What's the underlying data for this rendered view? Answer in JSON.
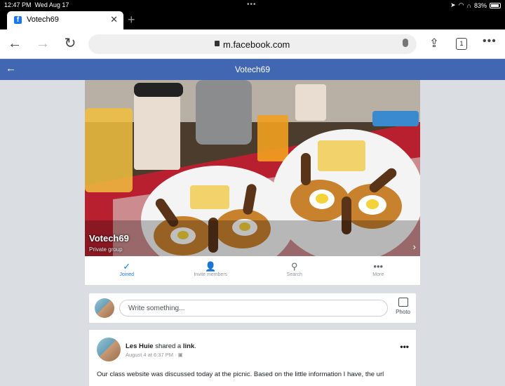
{
  "status_bar": {
    "time": "12:47 PM",
    "date": "Wed Aug 17",
    "battery": "83%"
  },
  "browser": {
    "tab_title": "Votech69",
    "url": "m.facebook.com",
    "tab_count": "1"
  },
  "header": {
    "title": "Votech69"
  },
  "group": {
    "name": "Votech69",
    "privacy": "Private group"
  },
  "actions": [
    {
      "label": "Joined",
      "icon": "checkmark-icon"
    },
    {
      "label": "Invite members",
      "icon": "add-person-icon"
    },
    {
      "label": "Search",
      "icon": "search-icon"
    },
    {
      "label": "More",
      "icon": "more-dots-icon"
    }
  ],
  "composer": {
    "placeholder": "Write something...",
    "photo_label": "Photo"
  },
  "post": {
    "author": "Les Huie",
    "action_text": " shared a ",
    "object": "link",
    "timestamp": "August 4 at 6:37 PM · ",
    "body": "Our class website was discussed today at the picnic. Based on the little information I have, the url"
  },
  "colors": {
    "facebook_blue": "#4267b2",
    "joined_blue": "#1877f2"
  }
}
